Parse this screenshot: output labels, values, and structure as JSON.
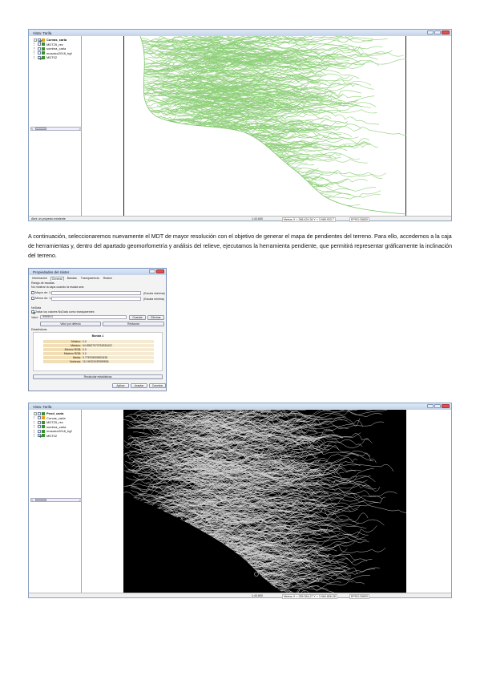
{
  "window1": {
    "title": "Vista: Tarifa",
    "layers": [
      {
        "label": "Curvas_carla",
        "checked": true,
        "bold": true,
        "color": "#e3a21a"
      },
      {
        "label": "MDT25_rec",
        "checked": false,
        "bold": false,
        "color": "#3b8f2d"
      },
      {
        "label": "sombra_carla",
        "checked": false,
        "bold": false,
        "color": "#3b8f2d"
      },
      {
        "label": "mosaico2018_hgf",
        "checked": false,
        "bold": false,
        "color": "#3b8f2d"
      },
      {
        "label": "MDT02",
        "checked": true,
        "bold": false,
        "color": "#3b8f2d"
      }
    ],
    "status_left": "Abrir un proyecto existente",
    "scale": "1:43.600",
    "coords": "Metros  X = 286.424,36  Y = 3.985.933,7",
    "epsg": "EPSG:25830"
  },
  "paragraph": "A continuación, seleccionaremos nuevamente el MDT de mayor resolución con el objetivo de generar el mapa de pendientes del terreno. Para ello, accedemos a la caja de herramientas y, dentro del apartado geomorfometría y análisis del relieve, ejecutamos la herramienta pendiente, que permitirá representar gráficamente la inclinación del terreno.",
  "dialog": {
    "title": "Propiedades del ráster",
    "tabs": [
      "Información",
      "General",
      "Bandas",
      "Transparencia",
      "Realce"
    ],
    "active_tab": "General",
    "scale_range": "Rango de escalas",
    "scale_note": "No mostrar la capa cuando la escala sea:",
    "greater_than": "Mayor de: 1:",
    "less_than": "Menor de: 1:",
    "scale_hint_max": "(Escala máxima)",
    "scale_hint_min": "(Escala mínima)",
    "nodata": "NoData",
    "nodata_check": "Tratar los valores NoData como transparentes",
    "value_label": "Valor:",
    "value": "-99999.0",
    "save": "Guardar",
    "delete": "Eliminar",
    "default": "Valor por defecto",
    "restore": "Restaurar",
    "stats_title": "Estadísticas",
    "band": "Banda 1",
    "stats": [
      {
        "k": "Mínimo:",
        "v": "0.0"
      },
      {
        "k": "Máximo:",
        "v": "64.89527573752533422"
      },
      {
        "k": "Mínimo RGB:",
        "v": "0.0"
      },
      {
        "k": "Máximo RGB:",
        "v": "0.0"
      },
      {
        "k": "Media:",
        "v": "9.778705909832435"
      },
      {
        "k": "Varianza:",
        "v": "111.96321639989836"
      }
    ],
    "recalc": "Recalcular estadísticas",
    "apply": "Aplicar",
    "accept": "Aceptar",
    "cancel": "Cancelar"
  },
  "window2": {
    "title": "Vista: Tarifa",
    "layers": [
      {
        "label": "Pend_carla",
        "checked": false,
        "bold": true,
        "color": "#3b8f2d"
      },
      {
        "label": "Curvas_carla",
        "checked": false,
        "bold": false,
        "color": "#e3a21a"
      },
      {
        "label": "MDT25_rec",
        "checked": false,
        "bold": false,
        "color": "#3b8f2d"
      },
      {
        "label": "sombra_carla",
        "checked": false,
        "bold": false,
        "color": "#3b8f2d"
      },
      {
        "label": "mosaico2018_hgf",
        "checked": false,
        "bold": false,
        "color": "#3b8f2d"
      },
      {
        "label": "MDT02",
        "checked": true,
        "bold": false,
        "color": "#3b8f2d"
      }
    ],
    "scale": "1:43.600",
    "coords": "Metros  X = 255.354,27  Y = 3.984.806,28",
    "epsg": "EPSG:25830"
  },
  "colors": {
    "contour": "#8fd07a",
    "slope_bg": "#000000",
    "slope_line": "#d8d8d8",
    "window_border": "#8aa1c0"
  }
}
